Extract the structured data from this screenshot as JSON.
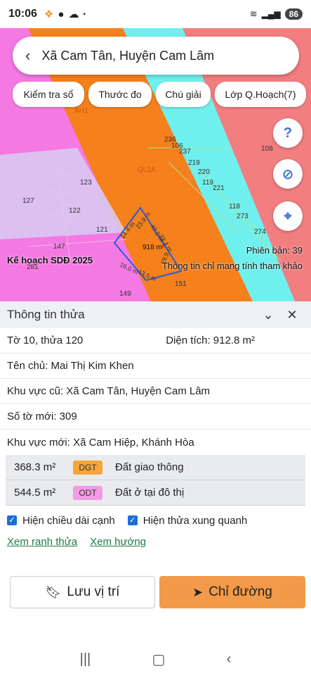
{
  "status": {
    "time": "10:06",
    "battery": "86"
  },
  "search": {
    "title": "Xã Cam Tân, Huyện Cam Lâm"
  },
  "chips": [
    "Kiểm tra sổ",
    "Thước đo",
    "Chú giải",
    "Lớp Q.Hoạch(7)"
  ],
  "map": {
    "labels": [
      "236",
      "106",
      "237",
      "219",
      "220",
      "119",
      "221",
      "118",
      "273",
      "274",
      "108",
      "123",
      "127",
      "122",
      "121",
      "147",
      "281",
      "149",
      "151",
      "AH1",
      "QL1A"
    ],
    "parcel_edges": [
      "14.4 m",
      "23.9 m",
      "40.0 m",
      "23.4 m",
      "918 m²",
      "28.9",
      "16.0 m",
      "13.5 m"
    ],
    "plan_label": "Kế hoạch SDĐ 2025",
    "version": "Phiên bản: 39",
    "note": "Thông tin chỉ mang tính tham khảo"
  },
  "panel": {
    "title": "Thông tin thửa",
    "sheet_parcel": "Tờ 10, thửa 120",
    "area": "Diện tích: 912.8 m²",
    "owner": "Tên chủ: Mai Thị Kim Khen",
    "old_area": "Khu vực cũ: Xã Cam Tân, Huyện Cam Lâm",
    "new_sheet": "Số tờ mới: 309",
    "new_area": "Khu vực mới: Xã Cam Hiệp, Khánh Hòa",
    "land_uses": [
      {
        "area": "368.3 m²",
        "code": "DGT",
        "name": "Đất giao thông"
      },
      {
        "area": "544.5 m²",
        "code": "ODT",
        "name": "Đất ở tại đô thị"
      }
    ],
    "check_edges": "Hiện chiều dài cạnh",
    "check_neighbors": "Hiện thửa xung quanh",
    "link_boundary": "Xem ranh thửa",
    "link_direction": "Xem hướng",
    "save_label": "Lưu vị trí",
    "directions_label": "Chỉ đường"
  }
}
